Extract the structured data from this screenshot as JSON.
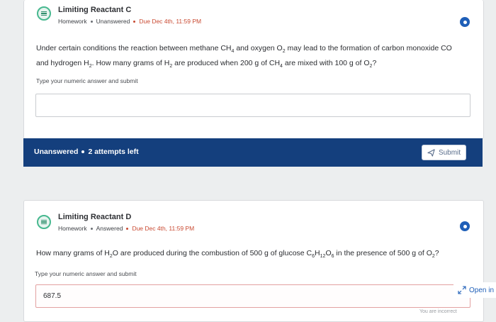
{
  "question_c": {
    "title": "Limiting Reactant C",
    "category": "Homework",
    "status": "Unanswered",
    "due": "Due Dec 4th, 11:59 PM",
    "text_part1": "Under certain conditions the reaction between methane ",
    "ch4": "CH",
    "ch4_sub": "4",
    "text_part2": " and oxygen ",
    "o2": "O",
    "o2_sub": "2",
    "text_part3": " may lead to the formation of carbon monoxide ",
    "co": "CO",
    "text_part4": "and hydrogen ",
    "h2": "H",
    "h2_sub": "2",
    "text_part5": ". How many grams of ",
    "text_part6": " are produced when 200 g of ",
    "text_part7": " are mixed with 100 g of ",
    "text_part8": "?",
    "answer_hint": "Type your numeric answer and submit",
    "answer_value": ""
  },
  "status_bar": {
    "status": "Unanswered",
    "attempts": "2 attempts left",
    "submit_label": "Submit"
  },
  "question_d": {
    "title": "Limiting Reactant D",
    "category": "Homework",
    "status": "Answered",
    "due": "Due Dec 4th, 11:59 PM",
    "text_part1": "How many grams of ",
    "h": "H",
    "h_sub": "2",
    "o": "O",
    "text_part2": " are produced during the combustion of 500 g of glucose ",
    "c": "C",
    "c_sub": "6",
    "h12": "H",
    "h12_sub": "12",
    "o6": "O",
    "o6_sub": "6",
    "text_part3": " in the presence of 500 g of ",
    "o2": "O",
    "o2_sub": "2",
    "text_part4": "?",
    "answer_hint": "Type your numeric answer and submit",
    "answer_value": "687.5"
  },
  "open_link": {
    "label": "Open in"
  },
  "footer": {
    "fade_text": "You are incorrect"
  },
  "colors": {
    "accent": "#1f5fb8",
    "status_bar": "#143f7d",
    "due": "#c94a32",
    "icon_green": "#47b88f"
  }
}
